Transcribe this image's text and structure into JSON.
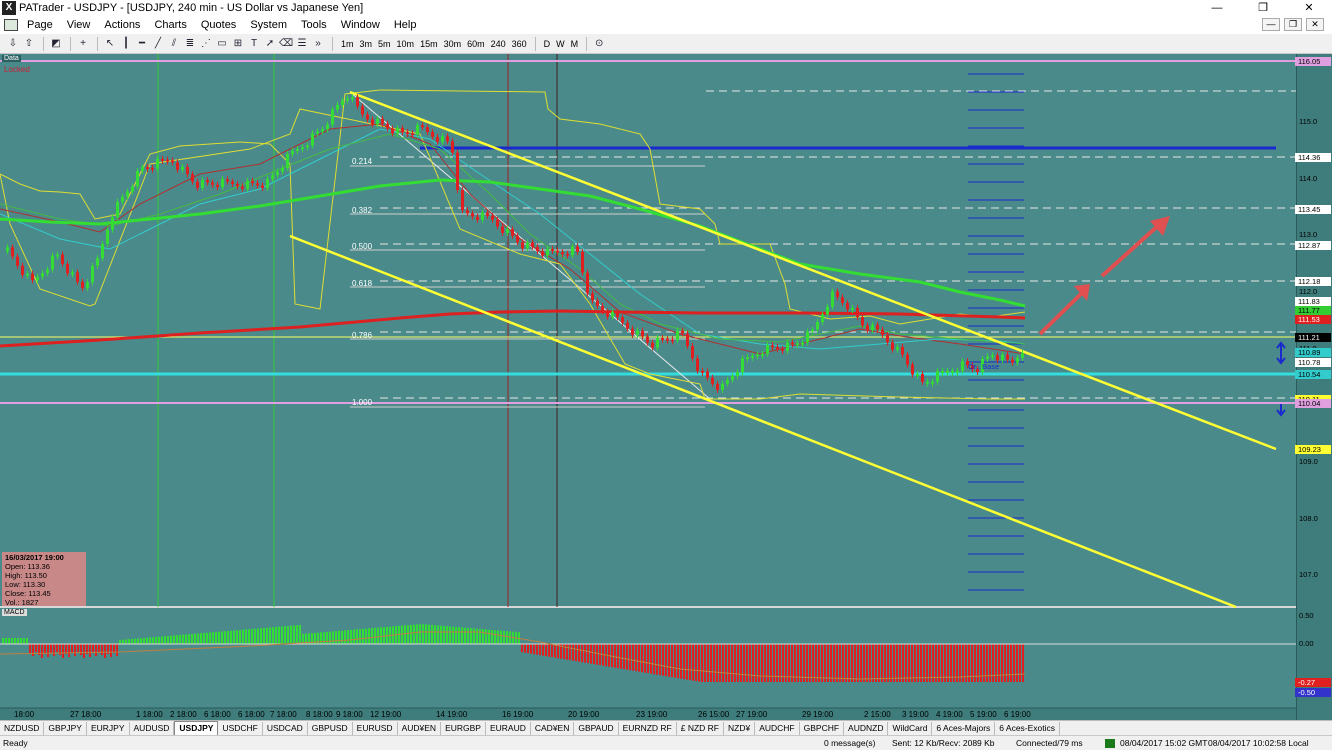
{
  "window": {
    "title": "PATrader - USDJPY - [USDJPY, 240 min - US Dollar vs Japanese Yen]",
    "app_icon": "X",
    "controls": [
      "—",
      "❐",
      "✕"
    ]
  },
  "menu": {
    "items": [
      "Page",
      "View",
      "Actions",
      "Charts",
      "Quotes",
      "System",
      "Tools",
      "Window",
      "Help"
    ],
    "mdi_controls": [
      "—",
      "❐",
      "✕"
    ]
  },
  "toolbar": {
    "overflow": "»",
    "timeframes": [
      "1m",
      "3m",
      "5m",
      "10m",
      "15m",
      "30m",
      "60m",
      "240",
      "360"
    ],
    "periods": [
      "D",
      "W",
      "M"
    ]
  },
  "chart": {
    "panel_label": "Data",
    "locked_label": "Locked",
    "inline_label": "Or.. Base",
    "fib_levels": [
      "0.214",
      "0.382",
      "0.500",
      "0.618",
      "0.786",
      "1.000"
    ],
    "y_axis_labels": [
      "116.0",
      "115.0",
      "114.0",
      "113.0",
      "112.0",
      "111.0",
      "110.0",
      "109.0",
      "108.0",
      "107.0"
    ],
    "price_tags": [
      {
        "text": "116.05",
        "bg": "#e0a0e0"
      },
      {
        "text": "114.36",
        "bg": "#ffffff"
      },
      {
        "text": "113.45",
        "bg": "#ffffff"
      },
      {
        "text": "112.87",
        "bg": "#ffffff"
      },
      {
        "text": "112.18",
        "bg": "#ffffff"
      },
      {
        "text": "111.83",
        "bg": "#ffffff"
      },
      {
        "text": "111.77",
        "bg": "#33cc33"
      },
      {
        "text": "111.53",
        "bg": "#e02020"
      },
      {
        "text": "111.21",
        "bg": "#000000"
      },
      {
        "text": "110.89",
        "bg": "#33cccc"
      },
      {
        "text": "110.78",
        "bg": "#ffffff"
      },
      {
        "text": "110.54",
        "bg": "#33cccc"
      },
      {
        "text": "110.11",
        "bg": "#ffff33"
      },
      {
        "text": "110.04",
        "bg": "#e0a0e0"
      },
      {
        "text": "109.23",
        "bg": "#ffff33"
      }
    ],
    "ohlc": {
      "date": "16/03/2017 19:00",
      "open": "Open: 113.36",
      "high": "High: 113.50",
      "low": "Low: 113.30",
      "close": "Close: 113.45",
      "vol": "Vol.: 1827"
    },
    "macd": {
      "label": "MACD",
      "axis_labels": [
        "0.50",
        "0.00"
      ],
      "tag": {
        "text": "-0.27",
        "bg": "#e02020"
      },
      "tag_low": {
        "text": "-0.50",
        "bg": "#3333cc"
      }
    },
    "x_axis_labels": [
      "18:00",
      "27 18:00",
      "1 18:00",
      "2 18:00",
      "6 18:00",
      "6 18:00",
      "7 18:00",
      "8 18:00",
      "9 18:00",
      "12 19:00",
      "14 19:00",
      "16 19:00",
      "20 19:00",
      "23 19:00",
      "26 15:00",
      "27 19:00",
      "29 19:00",
      "2 15:00",
      "3 19:00",
      "4 19:00",
      "5 19:00",
      "6 19:00"
    ]
  },
  "symbol_tabs": {
    "items": [
      "NZDUSD",
      "GBPJPY",
      "EURJPY",
      "AUDUSD",
      "USDJPY",
      "USDCHF",
      "USDCAD",
      "GBPUSD",
      "EURUSD",
      "AUD¥EN",
      "EURGBP",
      "EURAUD",
      "CAD¥EN",
      "GBPAUD",
      "EURNZD RF",
      "£ NZD RF",
      "NZD¥",
      "AUDCHF",
      "GBPCHF",
      "AUDNZD",
      "WildCard",
      "6 Aces-Majors",
      "6 Aces-Exotics"
    ],
    "active": "USDJPY"
  },
  "status": {
    "ready": "Ready",
    "messages": "0 message(s)",
    "sent_recv": "Sent: 12 Kb/Recv: 2089 Kb",
    "connected": "Connected/79 ms",
    "gmt_time": "08/04/2017 15:02 GMT",
    "local_time": "08/04/2017 10:02:58 Local"
  },
  "colors": {
    "chart_bg": "#4a8a8a",
    "bull": "#33dd33",
    "bear": "#e02020",
    "channel": "#ffff33",
    "fib": "#e8e8e8",
    "arrows": "#e05050"
  }
}
